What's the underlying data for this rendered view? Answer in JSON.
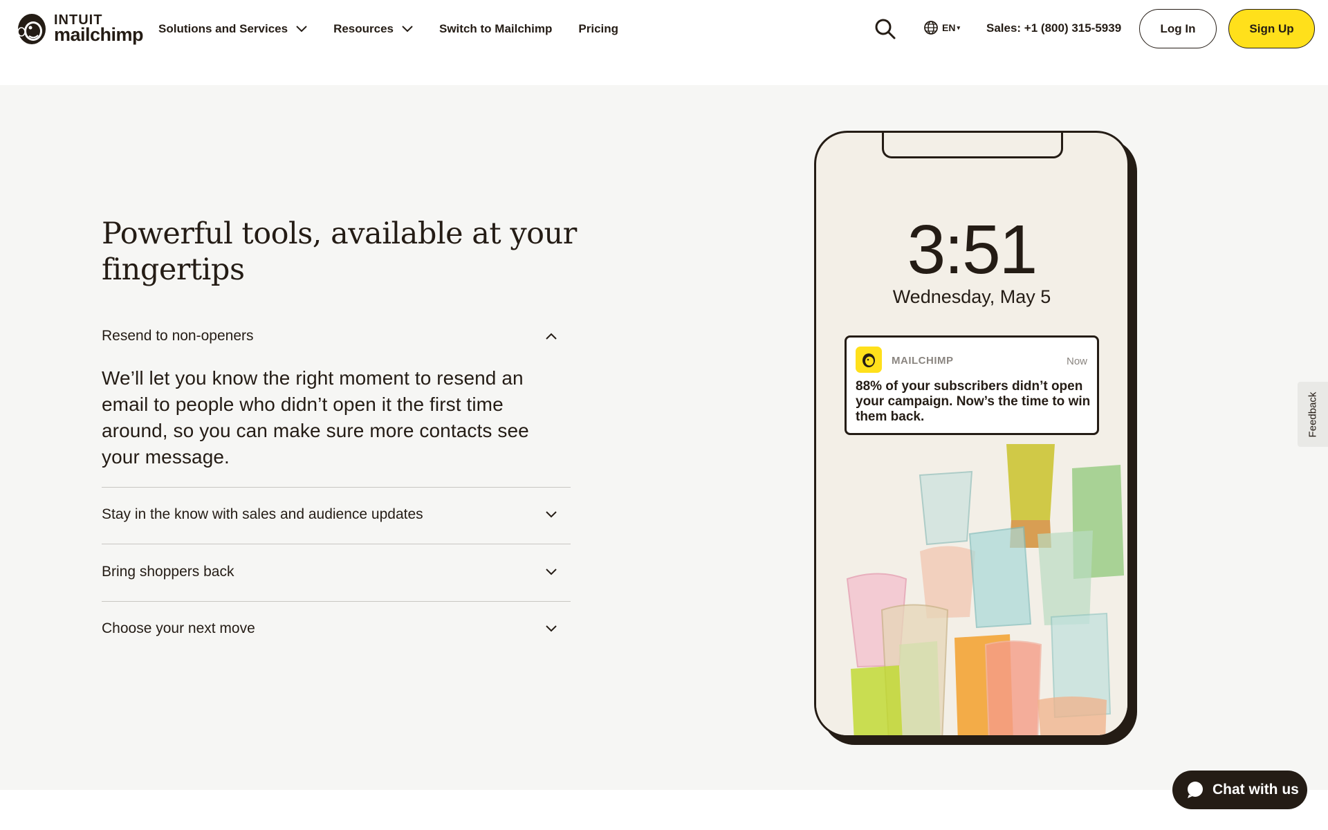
{
  "header": {
    "logo_top": "INTUIT",
    "logo_bottom": "mailchimp",
    "nav": [
      {
        "label": "Solutions and Services",
        "has_dropdown": true
      },
      {
        "label": "Resources",
        "has_dropdown": true
      },
      {
        "label": "Switch to Mailchimp",
        "has_dropdown": false
      },
      {
        "label": "Pricing",
        "has_dropdown": false
      }
    ],
    "language": "EN",
    "sales": "Sales: +1 (800) 315-5939",
    "login_label": "Log In",
    "signup_label": "Sign Up"
  },
  "main": {
    "title": "Powerful tools, available at your fingertips",
    "accordion": [
      {
        "label": "Resend to non-openers",
        "expanded": true,
        "description": "We’ll let you know the right moment to resend an email to people who didn’t open it the first time around, so you can make sure more contacts see your message."
      },
      {
        "label": "Stay in the know with sales and audience updates",
        "expanded": false
      },
      {
        "label": "Bring shoppers back",
        "expanded": false
      },
      {
        "label": "Choose your next move",
        "expanded": false
      }
    ]
  },
  "phone": {
    "time": "3:51",
    "date": "Wednesday, May 5",
    "notification": {
      "app": "MAILCHIMP",
      "time": "Now",
      "text": "88% of your subscribers didn’t open your campaign. Now’s the time to win them back."
    }
  },
  "feedback_label": "Feedback",
  "chat_label": "Chat with us",
  "colors": {
    "brand_yellow": "#ffe01b",
    "ink": "#241c15",
    "page_bg": "#f6f6f4"
  }
}
